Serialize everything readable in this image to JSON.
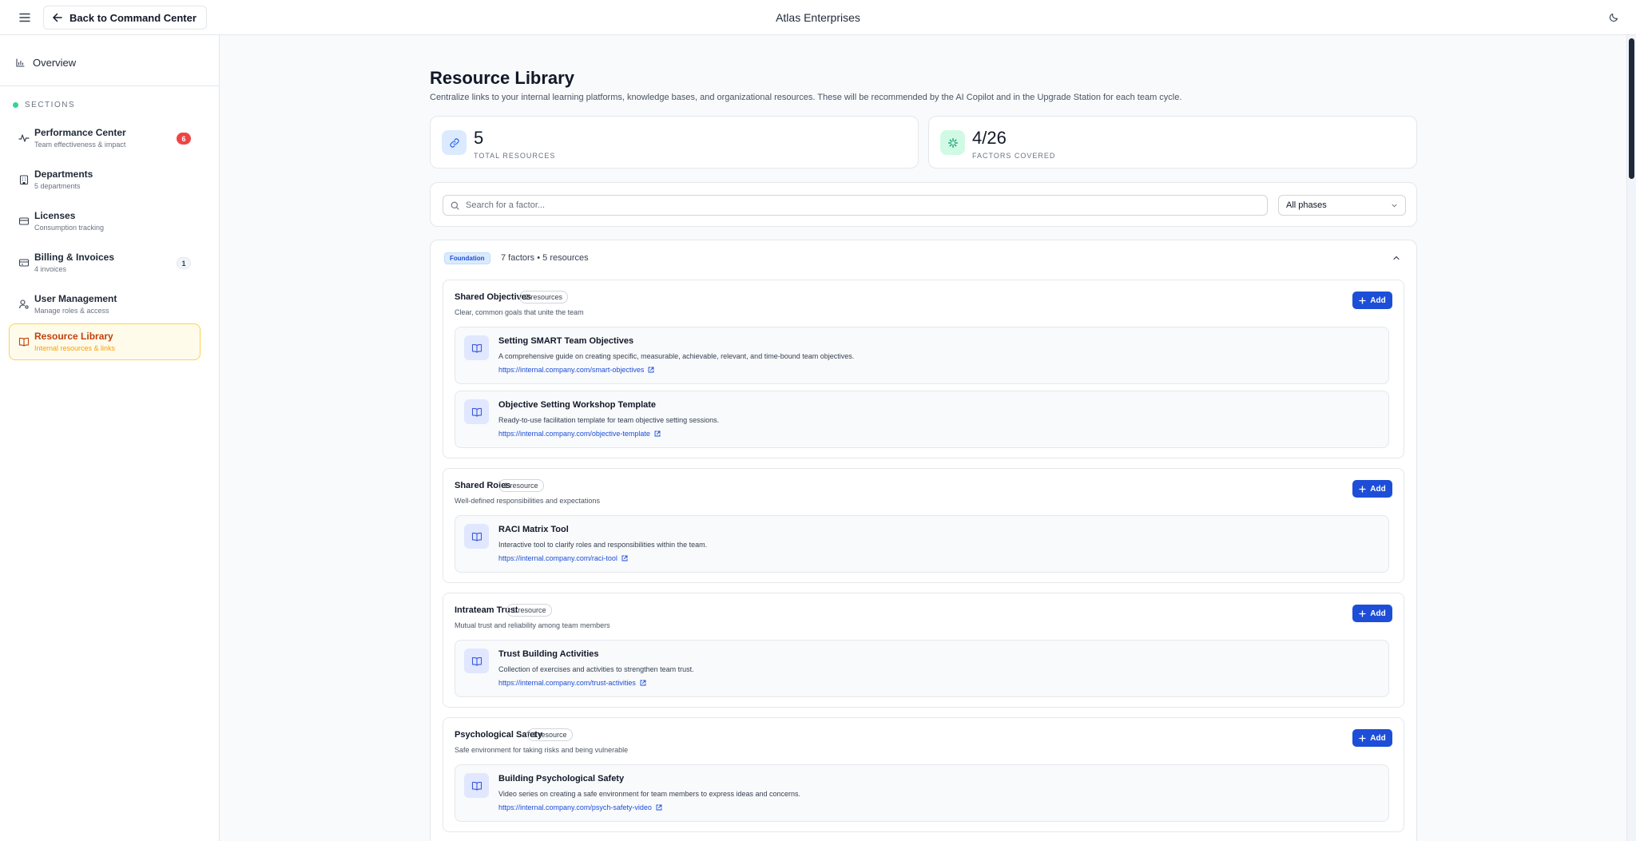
{
  "header": {
    "back_label": "Back to Command Center",
    "app_title": "Atlas Enterprises"
  },
  "sidebar": {
    "overview_label": "Overview",
    "sections_label": "SECTIONS",
    "items": [
      {
        "title": "Performance Center",
        "subtitle": "Team effectiveness & impact",
        "badge": "6",
        "icon": "activity-icon"
      },
      {
        "title": "Departments",
        "subtitle": "5 departments",
        "badge": "",
        "icon": "building-icon"
      },
      {
        "title": "Licenses",
        "subtitle": "Consumption tracking",
        "badge": "",
        "icon": "credit-card-icon"
      },
      {
        "title": "Billing & Invoices",
        "subtitle": "4 invoices",
        "badge": "1",
        "icon": "invoice-icon"
      },
      {
        "title": "User Management",
        "subtitle": "Manage roles & access",
        "badge": "",
        "icon": "user-cog-icon"
      },
      {
        "title": "Resource Library",
        "subtitle": "Internal resources & links",
        "badge": "",
        "icon": "book-icon",
        "active": true
      }
    ]
  },
  "main": {
    "title": "Resource Library",
    "description": "Centralize links to your internal learning platforms, knowledge bases, and organizational resources. These will be recommended by the AI Copilot and in the Upgrade Station for each team cycle.",
    "stats": [
      {
        "value": "5",
        "label": "TOTAL RESOURCES"
      },
      {
        "value": "4/26",
        "label": "FACTORS COVERED"
      }
    ],
    "search": {
      "placeholder": "Search for a factor...",
      "value": ""
    },
    "phase_filter": "All phases",
    "phase": {
      "tag": "Foundation",
      "summary": "7 factors • 5 resources",
      "add_label": "Add",
      "factors": [
        {
          "title": "Shared Objectives",
          "count": "2 resources",
          "description": "Clear, common goals that unite the team",
          "resources": [
            {
              "title": "Setting SMART Team Objectives",
              "description": "A comprehensive guide on creating specific, measurable, achievable, relevant, and time-bound team objectives.",
              "url": "https://internal.company.com/smart-objectives"
            },
            {
              "title": "Objective Setting Workshop Template",
              "description": "Ready-to-use facilitation template for team objective setting sessions.",
              "url": "https://internal.company.com/objective-template"
            }
          ]
        },
        {
          "title": "Shared Roles",
          "count": "1 resource",
          "description": "Well-defined responsibilities and expectations",
          "resources": [
            {
              "title": "RACI Matrix Tool",
              "description": "Interactive tool to clarify roles and responsibilities within the team.",
              "url": "https://internal.company.com/raci-tool"
            }
          ]
        },
        {
          "title": "Intrateam Trust",
          "count": "1 resource",
          "description": "Mutual trust and reliability among team members",
          "resources": [
            {
              "title": "Trust Building Activities",
              "description": "Collection of exercises and activities to strengthen team trust.",
              "url": "https://internal.company.com/trust-activities"
            }
          ]
        },
        {
          "title": "Psychological Safety",
          "count": "1 resource",
          "description": "Safe environment for taking risks and being vulnerable",
          "resources": [
            {
              "title": "Building Psychological Safety",
              "description": "Video series on creating a safe environment for team members to express ideas and concerns.",
              "url": "https://internal.company.com/psych-safety-video"
            }
          ]
        }
      ]
    }
  },
  "colors": {
    "accent": "#1d4ed8",
    "active_nav_bg": "#fffbeb",
    "active_nav_text": "#c2410c",
    "badge_red": "#ef4444"
  }
}
